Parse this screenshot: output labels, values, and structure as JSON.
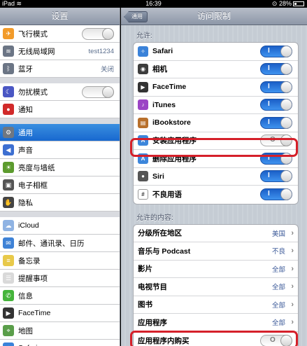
{
  "status": {
    "device": "iPad",
    "time": "16:39",
    "battery": "28%"
  },
  "left": {
    "title": "设置",
    "groups": [
      [
        {
          "label": "飞行模式",
          "icon": "airplane-icon",
          "color": "#f29b2a",
          "switch": "off"
        },
        {
          "label": "无线局域网",
          "icon": "wifi-icon",
          "color": "#6b7585",
          "value": "test1234"
        },
        {
          "label": "蓝牙",
          "icon": "bluetooth-icon",
          "color": "#6b7585",
          "value": "关闭"
        }
      ],
      [
        {
          "label": "勿扰模式",
          "icon": "moon-icon",
          "color": "#4a57c4",
          "switch": "off"
        },
        {
          "label": "通知",
          "icon": "notification-icon",
          "color": "#d12a2a"
        }
      ],
      [
        {
          "label": "通用",
          "icon": "gear-icon",
          "color": "#6f7782",
          "selected": true
        },
        {
          "label": "声音",
          "icon": "speaker-icon",
          "color": "#3d6fd1"
        },
        {
          "label": "亮度与墙纸",
          "icon": "sun-icon",
          "color": "#5c9b2e"
        },
        {
          "label": "电子相框",
          "icon": "picture-frame-icon",
          "color": "#555"
        },
        {
          "label": "隐私",
          "icon": "hand-icon",
          "color": "#444"
        }
      ],
      [
        {
          "label": "iCloud",
          "icon": "cloud-icon",
          "color": "#8fb3e3"
        },
        {
          "label": "邮件、通讯录、日历",
          "icon": "mail-icon",
          "color": "#3e82d6"
        },
        {
          "label": "备忘录",
          "icon": "notes-icon",
          "color": "#e8c94a"
        },
        {
          "label": "提醒事项",
          "icon": "reminders-icon",
          "color": "#d9d9d9"
        },
        {
          "label": "信息",
          "icon": "messages-icon",
          "color": "#45b43b"
        },
        {
          "label": "FaceTime",
          "icon": "facetime-icon",
          "color": "#333"
        },
        {
          "label": "地图",
          "icon": "map-icon",
          "color": "#5a9e4a"
        },
        {
          "label": "Safari",
          "icon": "safari-icon",
          "color": "#3a82d9"
        }
      ]
    ]
  },
  "right": {
    "back_label": "通用",
    "title": "访问限制",
    "allow_header": "允许:",
    "allow": [
      {
        "label": "Safari",
        "icon": "safari-icon",
        "color": "#3a82d9",
        "switch": "on",
        "switch_label": "I"
      },
      {
        "label": "相机",
        "icon": "camera-icon",
        "color": "#3d3d3d",
        "switch": "on",
        "switch_label": "I"
      },
      {
        "label": "FaceTime",
        "icon": "facetime-icon",
        "color": "#333",
        "switch": "on",
        "switch_label": "I"
      },
      {
        "label": "iTunes",
        "icon": "music-note-icon",
        "color": "#9b44c5",
        "switch": "on",
        "switch_label": "I"
      },
      {
        "label": "iBookstore",
        "icon": "book-icon",
        "color": "#b8702c",
        "switch": "on",
        "switch_label": "I"
      },
      {
        "label": "安装应用程序",
        "icon": "app-store-icon",
        "color": "#3c86db",
        "switch": "off",
        "switch_label": "O"
      },
      {
        "label": "删除应用程序",
        "icon": "app-store-icon",
        "color": "#3c86db",
        "switch": "on",
        "switch_label": "I"
      },
      {
        "label": "Siri",
        "icon": "microphone-icon",
        "color": "#555",
        "switch": "on",
        "switch_label": "I"
      },
      {
        "label": "不良用语",
        "icon": "profanity-icon",
        "color": "#fff",
        "switch": "on",
        "switch_label": "I"
      }
    ],
    "content_header": "允许的内容:",
    "content": [
      {
        "label": "分级所在地区",
        "value": "美国"
      },
      {
        "label": "音乐与 Podcast",
        "value": "不良"
      },
      {
        "label": "影片",
        "value": "全部"
      },
      {
        "label": "电视节目",
        "value": "全部"
      },
      {
        "label": "图书",
        "value": "全部"
      },
      {
        "label": "应用程序",
        "value": "全部"
      },
      {
        "label": "应用程序内购买",
        "switch": "off",
        "switch_label": "O"
      }
    ]
  },
  "highlight_color": "#d5202a"
}
